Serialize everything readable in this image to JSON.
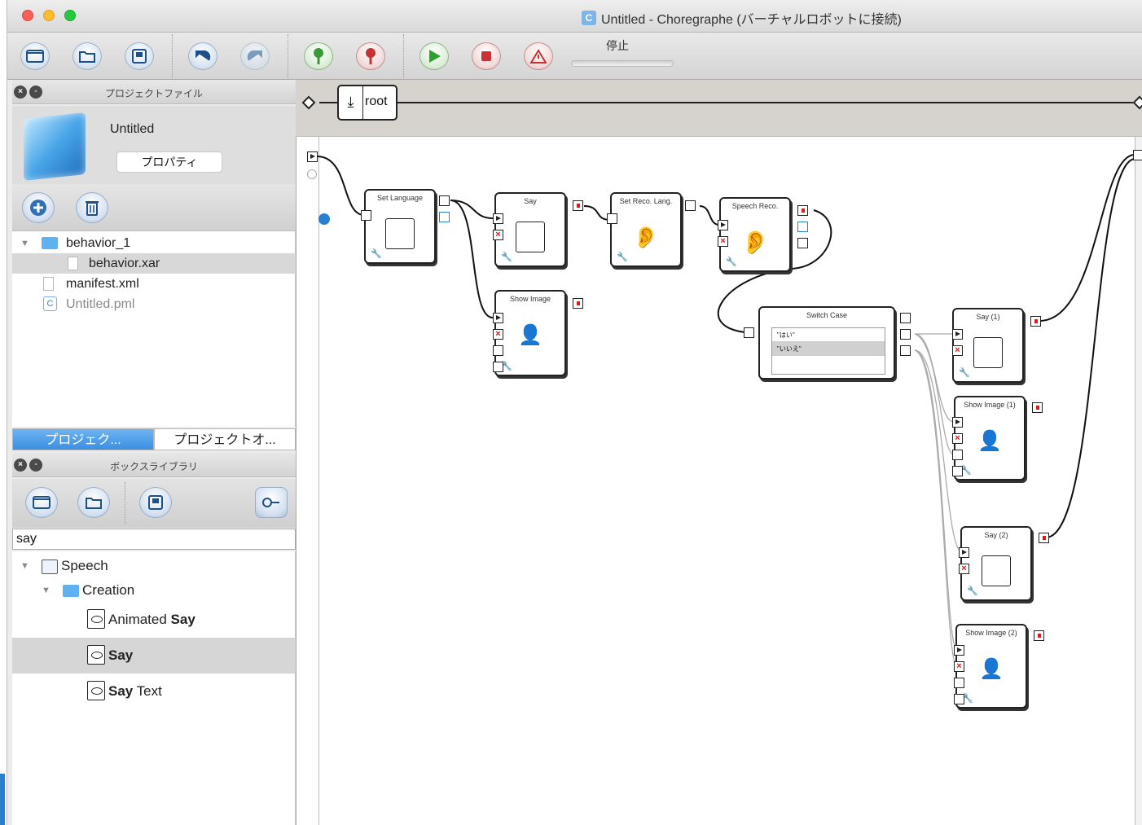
{
  "window": {
    "title": "Untitled - Choregraphe (バーチャルロボットに接続)",
    "title_icon": "C"
  },
  "toolbar": {
    "status_label": "停止",
    "buttons": [
      "new-window-icon",
      "open-folder-icon",
      "save-icon",
      "undo-icon",
      "redo-icon",
      "connect-icon",
      "disconnect-icon",
      "play-icon",
      "stop-icon",
      "warning-icon"
    ]
  },
  "project_panel": {
    "title": "プロジェクトファイル",
    "project_name": "Untitled",
    "properties_button": "プロパティ",
    "files": [
      {
        "label": "behavior_1",
        "type": "folder",
        "expanded": true
      },
      {
        "label": "behavior.xar",
        "type": "file",
        "selected": true
      },
      {
        "label": "manifest.xml",
        "type": "file"
      },
      {
        "label": "Untitled.pml",
        "type": "project"
      }
    ]
  },
  "tabs": [
    {
      "label": "プロジェク...",
      "active": true
    },
    {
      "label": "プロジェクトオ...",
      "active": false
    }
  ],
  "library_panel": {
    "title": "ボックスライブラリ",
    "search_value": "say",
    "tree": [
      {
        "label": "Speech",
        "type": "category"
      },
      {
        "label": "Creation",
        "type": "folder"
      },
      {
        "label_normal": "Animated ",
        "label_bold": "Say",
        "type": "box"
      },
      {
        "label_normal": "",
        "label_bold": "Say",
        "type": "box",
        "selected": true
      },
      {
        "label_bold": "Say",
        "label_normal": " Text",
        "type": "box"
      }
    ]
  },
  "flow": {
    "root_label": "root",
    "boxes": {
      "set_language": "Set Language",
      "say": "Say",
      "set_reco_lang": "Set Reco. Lang.",
      "speech_reco": "Speech Reco.",
      "show_image": "Show Image",
      "switch_case": "Switch Case",
      "say_1": "Say (1)",
      "show_image_1": "Show Image (1)",
      "say_2": "Say (2)",
      "show_image_2": "Show Image (2)"
    },
    "switch_cases": [
      "\"はい\"",
      "\"いいえ\""
    ]
  },
  "colors": {
    "accent": "#3b8fe0",
    "error_pin": "#d02020"
  }
}
